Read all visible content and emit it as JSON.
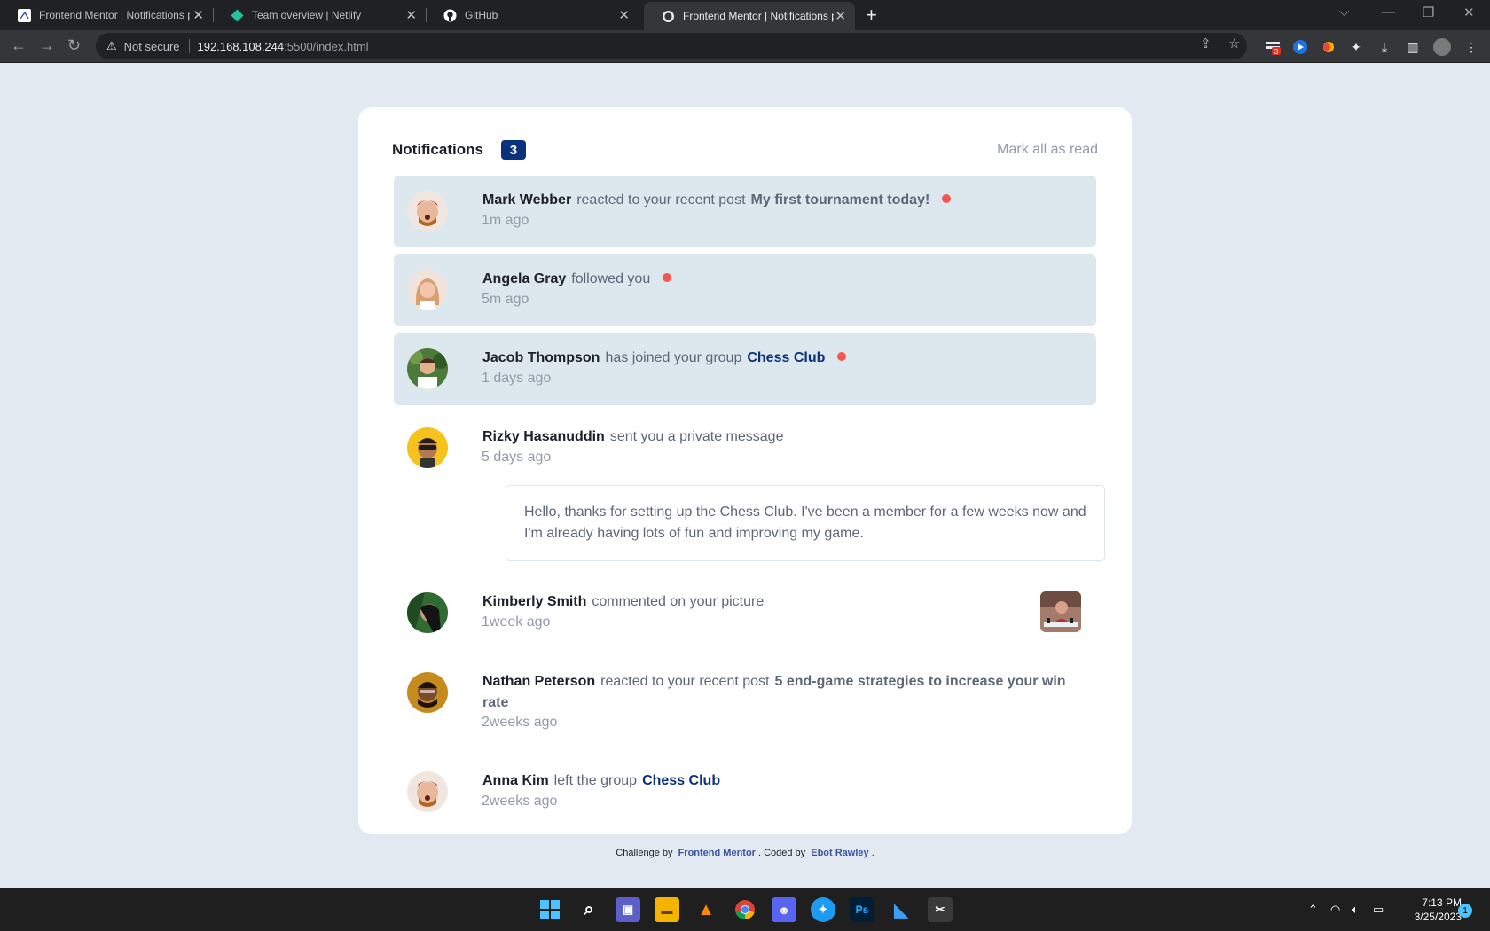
{
  "browser": {
    "tabs": [
      {
        "title": "Frontend Mentor | Notifications p",
        "active": false
      },
      {
        "title": "Team overview | Netlify",
        "active": false
      },
      {
        "title": "GitHub",
        "active": false
      },
      {
        "title": "Frontend Mentor | Notifications p",
        "active": true
      }
    ],
    "security_label": "Not secure",
    "url_host": "192.168.108.244",
    "url_path": ":5500/index.html",
    "extension_badge": "3"
  },
  "page": {
    "header": {
      "title": "Notifications",
      "unread_count": "3",
      "mark_all": "Mark all as read"
    },
    "notifications": [
      {
        "name": "Mark Webber",
        "action": "reacted to your recent post",
        "post": "My first tournament today!",
        "group": "",
        "time": "1m ago",
        "unread": true
      },
      {
        "name": "Angela Gray",
        "action": "followed you",
        "post": "",
        "group": "",
        "time": "5m ago",
        "unread": true
      },
      {
        "name": "Jacob Thompson",
        "action": "has joined your group",
        "post": "",
        "group": "Chess Club",
        "time": "1 days ago",
        "unread": true
      },
      {
        "name": "Rizky Hasanuddin",
        "action": "sent you a private message",
        "post": "",
        "group": "",
        "time": "5 days ago",
        "unread": false,
        "message": "Hello, thanks for setting up the Chess Club. I've been a member for a few weeks now and I'm already having lots of fun and improving my game."
      },
      {
        "name": "Kimberly Smith",
        "action": "commented on your picture",
        "post": "",
        "group": "",
        "time": "1week ago",
        "unread": false
      },
      {
        "name": "Nathan Peterson",
        "action": "reacted to your recent post",
        "post": "5 end-game strategies to increase your win rate",
        "group": "",
        "time": "2weeks ago",
        "unread": false
      },
      {
        "name": "Anna Kim",
        "action": "left the group",
        "post": "",
        "group": "Chess Club",
        "time": "2weeks ago",
        "unread": false
      }
    ],
    "footer": {
      "challenge_by": "Challenge by",
      "frontend_mentor": "Frontend Mentor",
      "coded_by": ". Coded by",
      "author": "Ebot Rawley",
      "end": "."
    }
  },
  "taskbar": {
    "time": "7:13 PM",
    "date": "3/25/2023",
    "notification_count": "1"
  }
}
